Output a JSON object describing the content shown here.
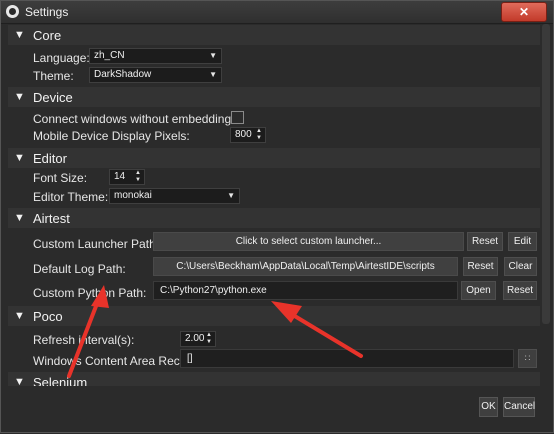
{
  "window": {
    "title": "Settings",
    "close_glyph": "✕"
  },
  "sections": {
    "core": {
      "title": "Core",
      "language_label": "Language:",
      "language_value": "zh_CN",
      "theme_label": "Theme:",
      "theme_value": "DarkShadow"
    },
    "device": {
      "title": "Device",
      "connect_label": "Connect windows without embedding:",
      "connect_checked": false,
      "pixels_label": "Mobile Device Display Pixels:",
      "pixels_value": "800"
    },
    "editor": {
      "title": "Editor",
      "font_size_label": "Font Size:",
      "font_size_value": "14",
      "theme_label": "Editor Theme:",
      "theme_value": "monokai"
    },
    "airtest": {
      "title": "Airtest",
      "launcher_label": "Custom Launcher Path:",
      "launcher_button": "Click to select custom launcher...",
      "launcher_reset": "Reset",
      "launcher_edit": "Edit",
      "log_label": "Default Log Path:",
      "log_value": "C:\\Users\\Beckham\\AppData\\Local\\Temp\\AirtestIDE\\scripts",
      "log_reset": "Reset",
      "log_clear": "Clear",
      "python_label": "Custom Python Path:",
      "python_value": "C:\\Python27\\python.exe",
      "python_open": "Open",
      "python_reset": "Reset"
    },
    "poco": {
      "title": "Poco",
      "refresh_label": "Refresh interval(s):",
      "refresh_value": "2.00",
      "rect_label": "Windows Content Area Rect:",
      "rect_value": "[]",
      "rect_button_glyph": "∷"
    },
    "selenium": {
      "title": "Selenium"
    }
  },
  "footer": {
    "ok": "OK",
    "cancel": "Cancel"
  },
  "icons": {
    "collapse": "▼",
    "dropdown": "▼",
    "spin": "▲▼",
    "annotation_color": "#e8332a"
  }
}
